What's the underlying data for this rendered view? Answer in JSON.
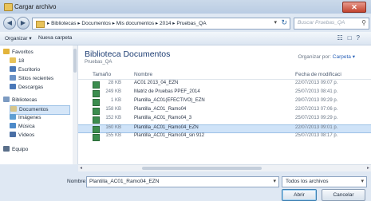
{
  "window": {
    "title": "Cargar archivo",
    "close_label": "✕"
  },
  "address": {
    "path": [
      "Bibliotecas",
      "Documentos",
      "Mis documentos",
      "2014",
      "Pruebas_QA"
    ],
    "search_placeholder": "Buscar Pruebas_QA"
  },
  "toolbar": {
    "organize": "Organizar ▾",
    "new_folder": "Nueva carpeta"
  },
  "nav": {
    "items": [
      {
        "label": "Favoritos",
        "icon": "star-icon",
        "color": "#e3b43a"
      },
      {
        "label": "18",
        "icon": "folder-icon",
        "color": "#e8c35a"
      },
      {
        "label": "Escritorio",
        "icon": "desktop-icon",
        "color": "#4a78b8"
      },
      {
        "label": "Sitios recientes",
        "icon": "recent-places-icon",
        "color": "#6c93c8"
      },
      {
        "label": "Descargas",
        "icon": "downloads-icon",
        "color": "#4a78b8"
      },
      {
        "label": "Bibliotecas",
        "icon": "libraries-icon",
        "color": "#7c9bc2"
      },
      {
        "label": "Documentos",
        "icon": "documents-icon",
        "color": "#d6c58a"
      },
      {
        "label": "Imágenes",
        "icon": "pictures-icon",
        "color": "#5f9fd3"
      },
      {
        "label": "Música",
        "icon": "music-icon",
        "color": "#4d8ac9"
      },
      {
        "label": "Vídeos",
        "icon": "videos-icon",
        "color": "#4a6fa5"
      },
      {
        "label": "Equipo",
        "icon": "computer-icon",
        "color": "#5a6f8a"
      }
    ]
  },
  "library": {
    "title": "Biblioteca Documentos",
    "subtitle": "Pruebas_QA",
    "arrange_label": "Organizar por:",
    "arrange_value": "Carpeta ▾"
  },
  "columns": {
    "size": "Tamaño",
    "name": "Nombre",
    "date": "Fecha de modificaci"
  },
  "files": [
    {
      "size": "28 KB",
      "name": "AC01 2013_04_EZN",
      "date": "22/07/2013 09:07 p.",
      "selected": false
    },
    {
      "size": "249 KB",
      "name": "Matriz de Pruebas PPEF_2014",
      "date": "25/07/2013 08:41 p.",
      "selected": false
    },
    {
      "size": "1 KB",
      "name": "Plantilla_AC01(EFECTIVO)_EZN",
      "date": "29/07/2013 09:29 p.",
      "selected": false
    },
    {
      "size": "158 KB",
      "name": "Plantilla_AC01_Ramo04",
      "date": "22/07/2013 07:06 p.",
      "selected": false
    },
    {
      "size": "152 KB",
      "name": "Plantilla_AC01_Ramo04_3",
      "date": "25/07/2013 09:29 p.",
      "selected": false
    },
    {
      "size": "160 KB",
      "name": "Plantilla_AC01_Ramo04_EZN",
      "date": "22/07/2013 09:01 p.",
      "selected": true
    },
    {
      "size": "155 KB",
      "name": "Plantilla_AC01_Ramo04_sin 912",
      "date": "25/07/2013 08:17 p.",
      "selected": false
    }
  ],
  "footer": {
    "filename_label": "Nombre:",
    "filename_value": "Plantilla_AC01_Ramo04_EZN",
    "filetype_value": "Todos los archivos",
    "open_label": "Abrir",
    "cancel_label": "Cancelar"
  }
}
